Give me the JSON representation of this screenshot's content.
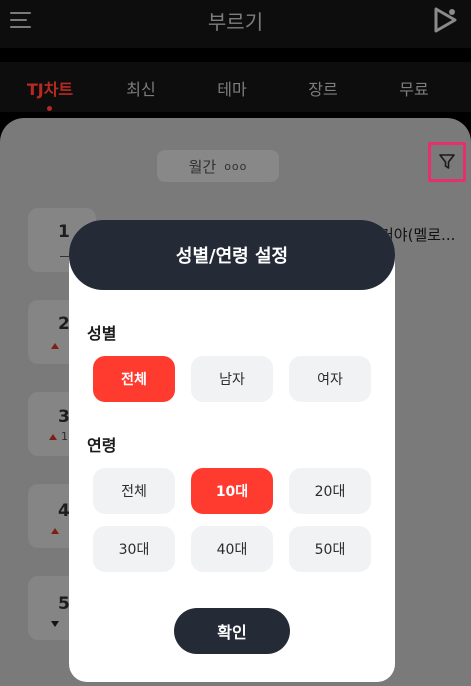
{
  "appbar": {
    "title": "부르기"
  },
  "tabs": [
    {
      "label": "TJ차트",
      "active": true
    },
    {
      "label": "최신"
    },
    {
      "label": "테마"
    },
    {
      "label": "장르"
    },
    {
      "label": "무료"
    }
  ],
  "filter": {
    "period_label": "월간",
    "period_more": "ooo"
  },
  "chart_list": {
    "song_peek": "거야(멜로...",
    "ranks": [
      {
        "num": "1",
        "trend": "same"
      },
      {
        "num": "2",
        "trend": "up"
      },
      {
        "num": "3",
        "trend": "up",
        "change": "1"
      },
      {
        "num": "4",
        "trend": "up"
      },
      {
        "num": "5",
        "trend": "down"
      }
    ]
  },
  "modal": {
    "title": "성별/연령 설정",
    "gender": {
      "label": "성별",
      "options": [
        "전체",
        "남자",
        "여자"
      ],
      "selected": "전체"
    },
    "age": {
      "label": "연령",
      "options": [
        "전체",
        "10대",
        "20대",
        "30대",
        "40대",
        "50대"
      ],
      "selected": "10대"
    },
    "confirm_label": "확인"
  },
  "colors": {
    "accent": "#ff3b30",
    "dark": "#252a37",
    "highlight": "#e4306e"
  }
}
